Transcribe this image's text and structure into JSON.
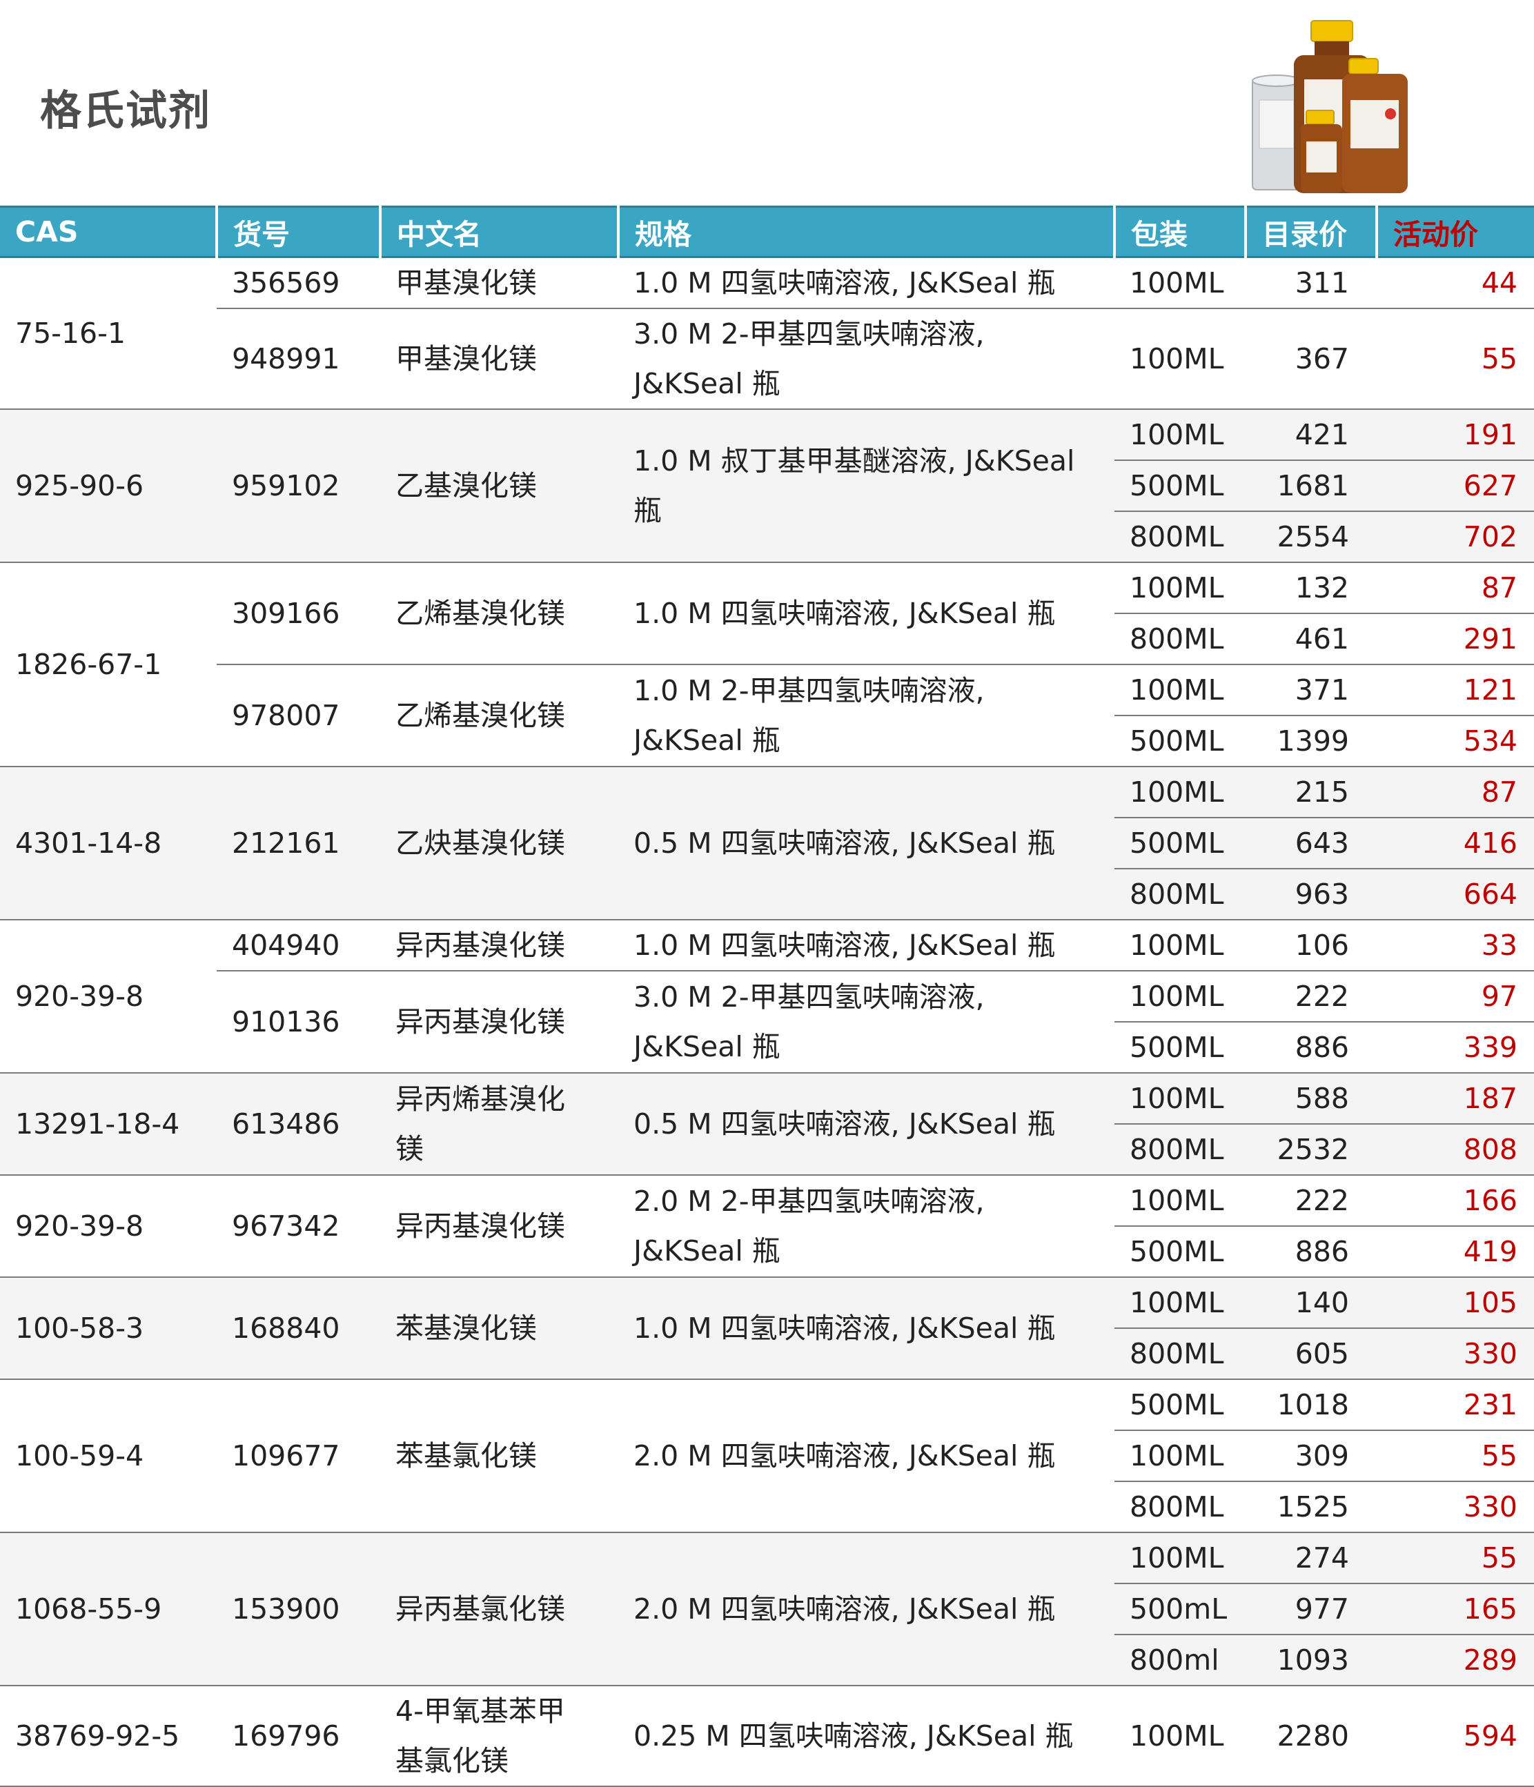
{
  "title": "格氏试剂",
  "headers": {
    "cas": "CAS",
    "item_no": "货号",
    "cn_name": "中文名",
    "spec": "规格",
    "pack": "包装",
    "list_price": "目录价",
    "promo_price": "活动价"
  },
  "accent_colors": {
    "header_bg": "#3aa6c4",
    "promo_text": "#c00000",
    "title_text": "#4d4d4d"
  },
  "groups": [
    {
      "cas": "75-16-1",
      "products": [
        {
          "item_no": "356569",
          "name": "甲基溴化镁",
          "spec": "1.0 M 四氢呋喃溶液, J&KSeal 瓶",
          "packs": [
            {
              "size": "100ML",
              "list": "311",
              "promo": "44"
            }
          ]
        },
        {
          "item_no": "948991",
          "name": "甲基溴化镁",
          "spec": "3.0 M 2-甲基四氢呋喃溶液, J&KSeal 瓶",
          "packs": [
            {
              "size": "100ML",
              "list": "367",
              "promo": "55"
            }
          ]
        }
      ]
    },
    {
      "cas": "925-90-6",
      "products": [
        {
          "item_no": "959102",
          "name": "乙基溴化镁",
          "spec": "1.0 M 叔丁基甲基醚溶液, J&KSeal 瓶",
          "packs": [
            {
              "size": "100ML",
              "list": "421",
              "promo": "191"
            },
            {
              "size": "500ML",
              "list": "1681",
              "promo": "627"
            },
            {
              "size": "800ML",
              "list": "2554",
              "promo": "702"
            }
          ]
        }
      ]
    },
    {
      "cas": "1826-67-1",
      "products": [
        {
          "item_no": "309166",
          "name": "乙烯基溴化镁",
          "spec": "1.0 M 四氢呋喃溶液, J&KSeal 瓶",
          "packs": [
            {
              "size": "100ML",
              "list": "132",
              "promo": "87"
            },
            {
              "size": "800ML",
              "list": "461",
              "promo": "291"
            }
          ]
        },
        {
          "item_no": "978007",
          "name": "乙烯基溴化镁",
          "spec": "1.0 M 2-甲基四氢呋喃溶液, J&KSeal 瓶",
          "packs": [
            {
              "size": "100ML",
              "list": "371",
              "promo": "121"
            },
            {
              "size": "500ML",
              "list": "1399",
              "promo": "534"
            }
          ]
        }
      ]
    },
    {
      "cas": "4301-14-8",
      "products": [
        {
          "item_no": "212161",
          "name": "乙炔基溴化镁",
          "spec": "0.5 M 四氢呋喃溶液, J&KSeal 瓶",
          "packs": [
            {
              "size": "100ML",
              "list": "215",
              "promo": "87"
            },
            {
              "size": "500ML",
              "list": "643",
              "promo": "416"
            },
            {
              "size": "800ML",
              "list": "963",
              "promo": "664"
            }
          ]
        }
      ]
    },
    {
      "cas": "920-39-8",
      "products": [
        {
          "item_no": "404940",
          "name": "异丙基溴化镁",
          "spec": "1.0 M 四氢呋喃溶液, J&KSeal 瓶",
          "packs": [
            {
              "size": "100ML",
              "list": "106",
              "promo": "33"
            }
          ]
        },
        {
          "item_no": "910136",
          "name": "异丙基溴化镁",
          "spec": "3.0 M 2-甲基四氢呋喃溶液, J&KSeal 瓶",
          "packs": [
            {
              "size": "100ML",
              "list": "222",
              "promo": "97"
            },
            {
              "size": "500ML",
              "list": "886",
              "promo": "339"
            }
          ]
        }
      ]
    },
    {
      "cas": "13291-18-4",
      "products": [
        {
          "item_no": "613486",
          "name": "异丙烯基溴化镁",
          "spec": "0.5 M 四氢呋喃溶液, J&KSeal 瓶",
          "packs": [
            {
              "size": "100ML",
              "list": "588",
              "promo": "187"
            },
            {
              "size": "800ML",
              "list": "2532",
              "promo": "808"
            }
          ]
        }
      ]
    },
    {
      "cas": "920-39-8",
      "products": [
        {
          "item_no": "967342",
          "name": "异丙基溴化镁",
          "spec": "2.0 M 2-甲基四氢呋喃溶液, J&KSeal 瓶",
          "packs": [
            {
              "size": "100ML",
              "list": "222",
              "promo": "166"
            },
            {
              "size": "500ML",
              "list": "886",
              "promo": "419"
            }
          ]
        }
      ]
    },
    {
      "cas": "100-58-3",
      "products": [
        {
          "item_no": "168840",
          "name": "苯基溴化镁",
          "spec": "1.0 M 四氢呋喃溶液, J&KSeal 瓶",
          "packs": [
            {
              "size": "100ML",
              "list": "140",
              "promo": "105"
            },
            {
              "size": "800ML",
              "list": "605",
              "promo": "330"
            }
          ]
        }
      ]
    },
    {
      "cas": "100-59-4",
      "products": [
        {
          "item_no": "109677",
          "name": "苯基氯化镁",
          "spec": "2.0 M 四氢呋喃溶液, J&KSeal 瓶",
          "packs": [
            {
              "size": "500ML",
              "list": "1018",
              "promo": "231"
            },
            {
              "size": "100ML",
              "list": "309",
              "promo": "55"
            },
            {
              "size": "800ML",
              "list": "1525",
              "promo": "330"
            }
          ]
        }
      ]
    },
    {
      "cas": "1068-55-9",
      "products": [
        {
          "item_no": "153900",
          "name": "异丙基氯化镁",
          "spec": "2.0 M 四氢呋喃溶液, J&KSeal 瓶",
          "packs": [
            {
              "size": "100ML",
              "list": "274",
              "promo": "55"
            },
            {
              "size": "500mL",
              "list": "977",
              "promo": "165"
            },
            {
              "size": "800ml",
              "list": "1093",
              "promo": "289"
            }
          ]
        }
      ]
    },
    {
      "cas": "38769-92-5",
      "products": [
        {
          "item_no": "169796",
          "name": "4-甲氧基苯甲基氯化镁",
          "spec": "0.25 M 四氢呋喃溶液, J&KSeal 瓶",
          "packs": [
            {
              "size": "100ML",
              "list": "2280",
              "promo": "594"
            }
          ]
        }
      ]
    }
  ]
}
